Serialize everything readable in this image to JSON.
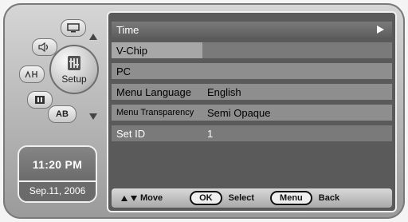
{
  "menu": {
    "rows": [
      {
        "label": "Time",
        "value": ""
      },
      {
        "label": "V-Chip",
        "value": ""
      },
      {
        "label": "PC",
        "value": ""
      },
      {
        "label": "Menu Language",
        "value": "English"
      },
      {
        "label": "Menu Transparency",
        "value": "Semi Opaque"
      },
      {
        "label": "Set ID",
        "value": "1"
      }
    ]
  },
  "dial": {
    "center_label": "Setup",
    "segment_ab_label": "AB"
  },
  "clock": {
    "time": "11:20 PM",
    "date": "Sep.11, 2006"
  },
  "help": {
    "move_label": "Move",
    "ok_key": "OK",
    "ok_label": "Select",
    "menu_key": "Menu",
    "menu_label": "Back"
  },
  "icons": [
    "picture-icon",
    "sound-icon",
    "channel-icon",
    "input-icon",
    "setup-icon",
    "arrow-up-icon",
    "arrow-down-icon",
    "play-arrow-icon"
  ]
}
